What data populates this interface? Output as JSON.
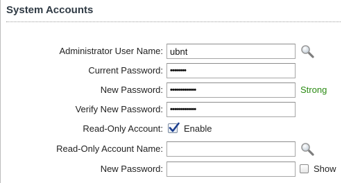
{
  "panel": {
    "title": "System Accounts"
  },
  "fields": {
    "admin_user": {
      "label": "Administrator User Name:",
      "value": "ubnt"
    },
    "current_password": {
      "label": "Current Password:",
      "value": "••••••••"
    },
    "new_password": {
      "label": "New Password:",
      "value": "•••••••••••••",
      "strength": "Strong"
    },
    "verify_password": {
      "label": "Verify New Password:",
      "value": "•••••••••••••"
    },
    "readonly_account": {
      "label": "Read-Only Account:",
      "checkbox_label": "Enable",
      "checked": true
    },
    "readonly_name": {
      "label": "Read-Only Account Name:",
      "value": ""
    },
    "readonly_password": {
      "label": "New Password:",
      "value": "",
      "show_label": "Show",
      "show_checked": false
    }
  },
  "colors": {
    "strength_strong": "#2a8a12",
    "checkmark": "#1c3f8f"
  },
  "icons": {
    "lookup": "magnifier-icon"
  }
}
